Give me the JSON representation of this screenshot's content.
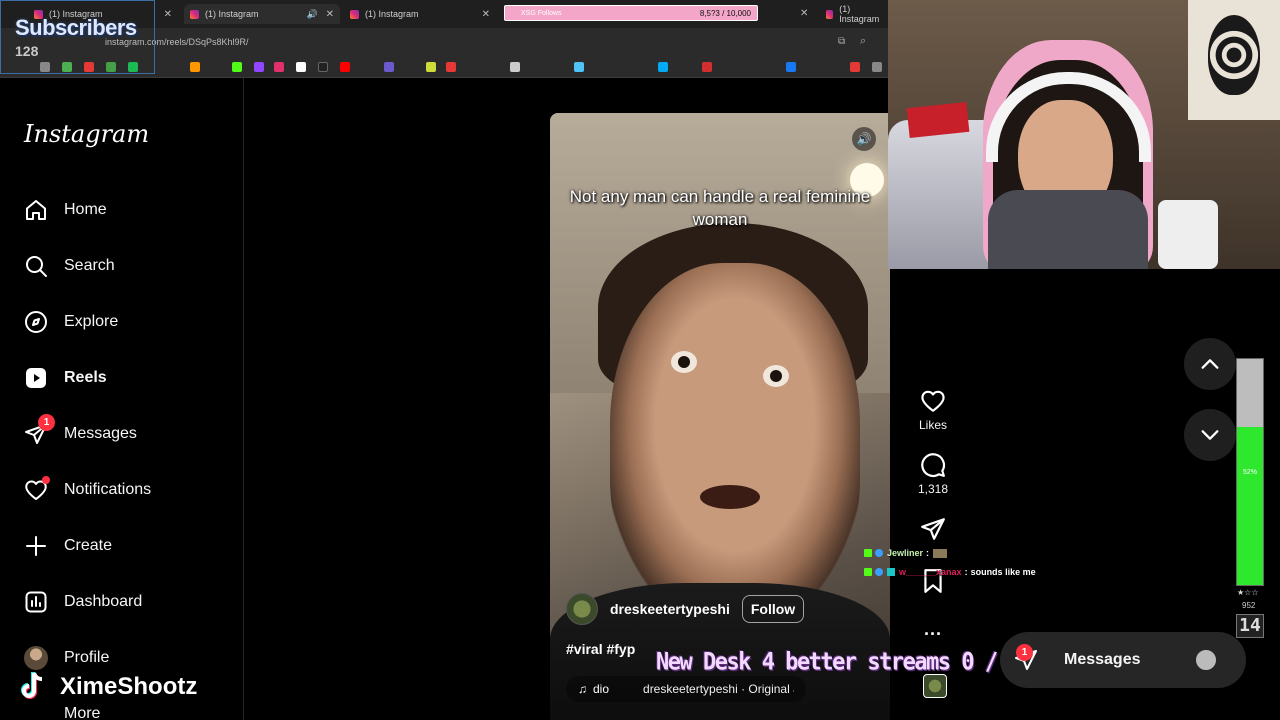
{
  "browser": {
    "tabs": [
      {
        "label": "(1) Instagram"
      },
      {
        "label": "(1) Instagram"
      },
      {
        "label": "(1) Instagram"
      },
      {
        "label": "(1) Instagram"
      }
    ],
    "goal_label": "XSG Follows",
    "goal_count": "8,5?3 / 10,000",
    "url": "instagram.com/reels/DSqPs8Khl9R/"
  },
  "overlay": {
    "subscribers_title": "Subscribers",
    "subscribers_count": "128",
    "tiktok_name": "XimeShootz",
    "desk_goal": "New Desk 4 better streams  0 / 85",
    "meter_pct": "52%",
    "meter_fill": 0.7,
    "meter_stars": "★☆☆",
    "meter_small": "952",
    "meter_num": "14"
  },
  "sidebar": {
    "logo": "Instagram",
    "items": [
      {
        "label": "Home",
        "icon": "home-icon"
      },
      {
        "label": "Search",
        "icon": "search-icon"
      },
      {
        "label": "Explore",
        "icon": "compass-icon"
      },
      {
        "label": "Reels",
        "icon": "reels-icon"
      },
      {
        "label": "Messages",
        "icon": "messenger-icon",
        "badge": "1"
      },
      {
        "label": "Notifications",
        "icon": "heart-icon"
      },
      {
        "label": "Create",
        "icon": "plus-icon"
      },
      {
        "label": "Dashboard",
        "icon": "dashboard-icon"
      },
      {
        "label": "Profile",
        "icon": "avatar"
      },
      {
        "label": "More",
        "icon": "menu-icon"
      }
    ]
  },
  "reel": {
    "caption": "Not any man can handle a real feminine woman",
    "username": "dreskeetertypeshi",
    "follow_label": "Follow",
    "tags": "#viral #fyp",
    "audio_title": "dio",
    "audio_source": "dreskeetertypeshi · Original au"
  },
  "actions": {
    "likes_label": "Likes",
    "comments_count": "1,318"
  },
  "chat": [
    {
      "user": "Jewliner",
      "message": ""
    },
    {
      "user": "w______xanax",
      "message": "sounds like me"
    }
  ],
  "messages_pill": {
    "label": "Messages",
    "badge": "1"
  },
  "colors": {
    "accent_red": "#ff3040",
    "goal_pink": "#f4a6c9",
    "meter_green": "#2ee82e"
  }
}
